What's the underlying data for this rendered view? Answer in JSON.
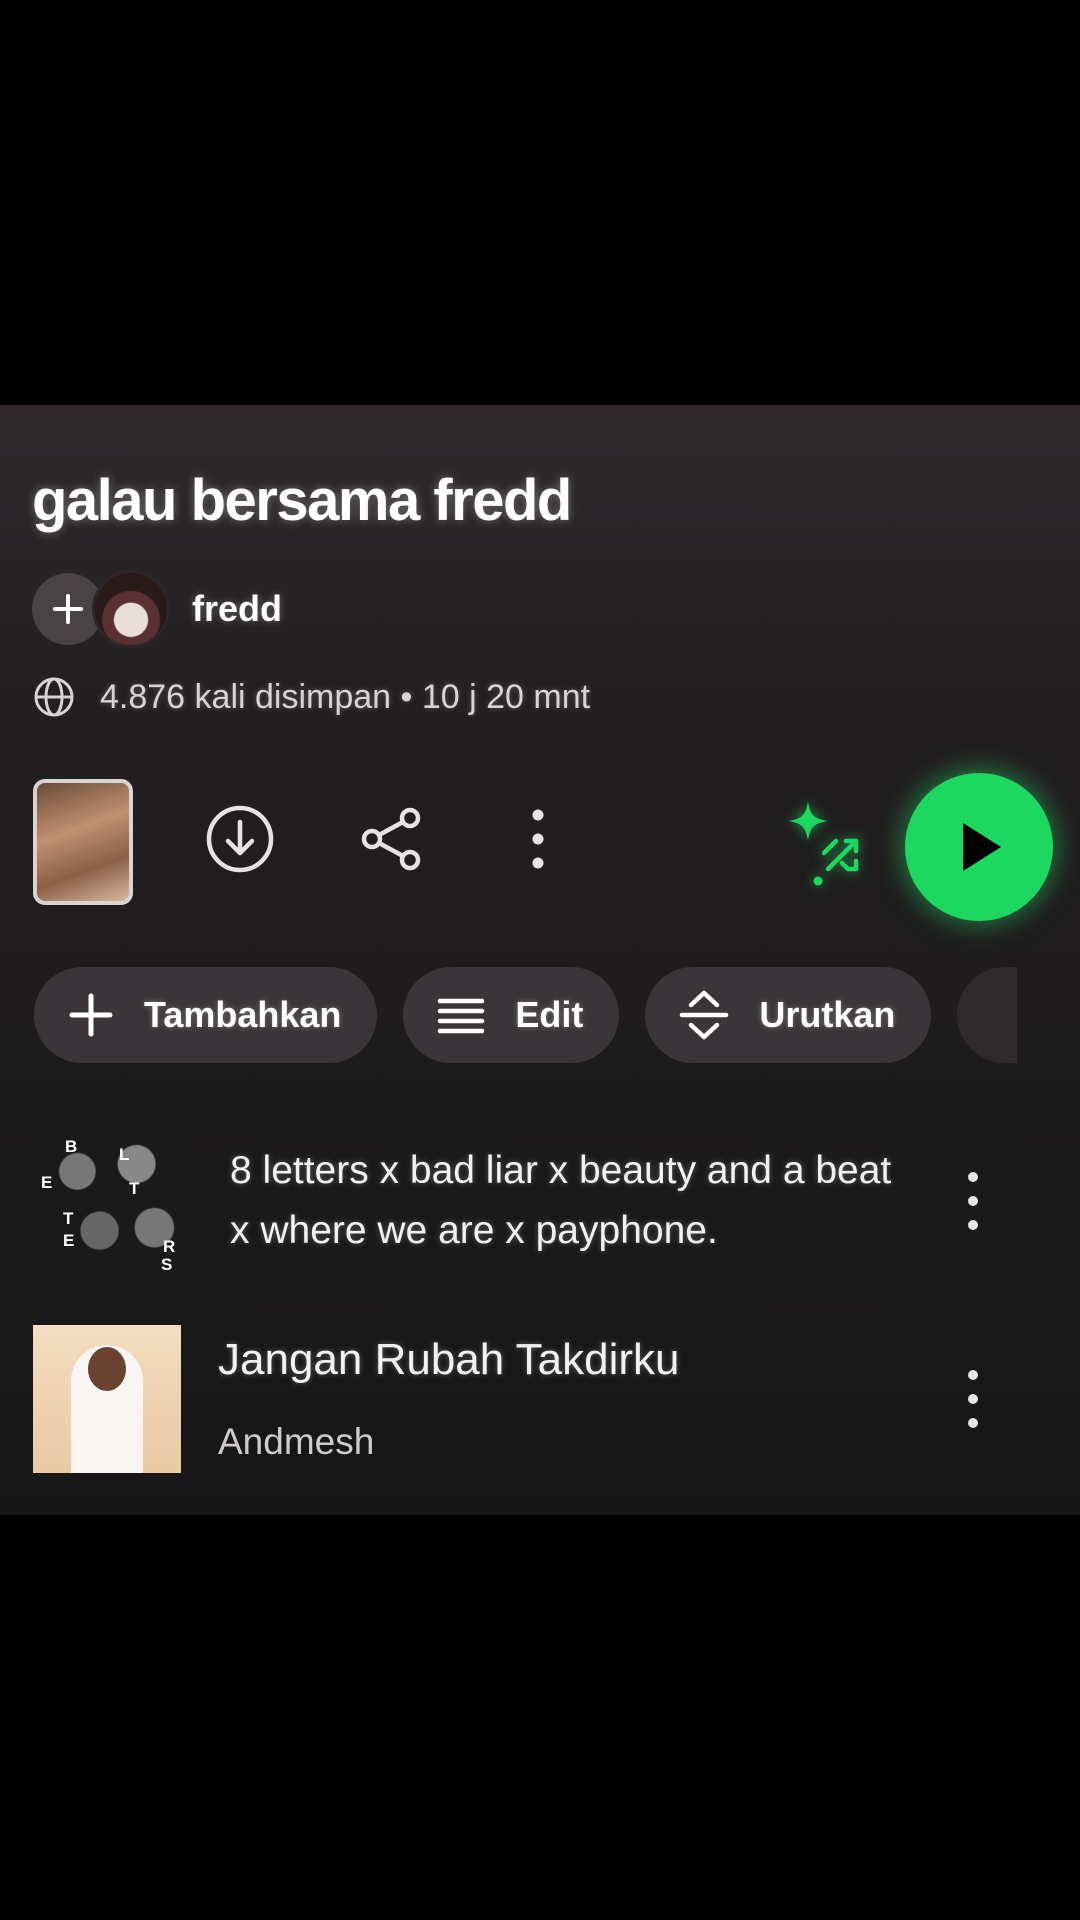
{
  "playlist": {
    "title": "galau bersama fredd",
    "owner": "fredd",
    "meta": "4.876 kali disimpan • 10 j 20 mnt"
  },
  "actions": {
    "download_icon": "download-circle-icon",
    "share_icon": "share-icon",
    "more_icon": "more-vertical-icon",
    "smart_shuffle_icon": "smart-shuffle-icon",
    "play_icon": "play-icon",
    "accent": "#1ed760"
  },
  "chips": [
    {
      "label": "Tambahkan",
      "icon": "plus-icon"
    },
    {
      "label": "Edit",
      "icon": "list-icon"
    },
    {
      "label": "Urutkan",
      "icon": "sort-icon"
    }
  ],
  "tracks": [
    {
      "title": "8 letters x bad liar x beauty and a beat x where we are x payphone.",
      "artist": "",
      "art_letters": [
        "B",
        "L",
        "E",
        "T",
        "T",
        "E",
        "R",
        "S"
      ]
    },
    {
      "title": "Jangan Rubah Takdirku",
      "artist": "Andmesh"
    }
  ]
}
